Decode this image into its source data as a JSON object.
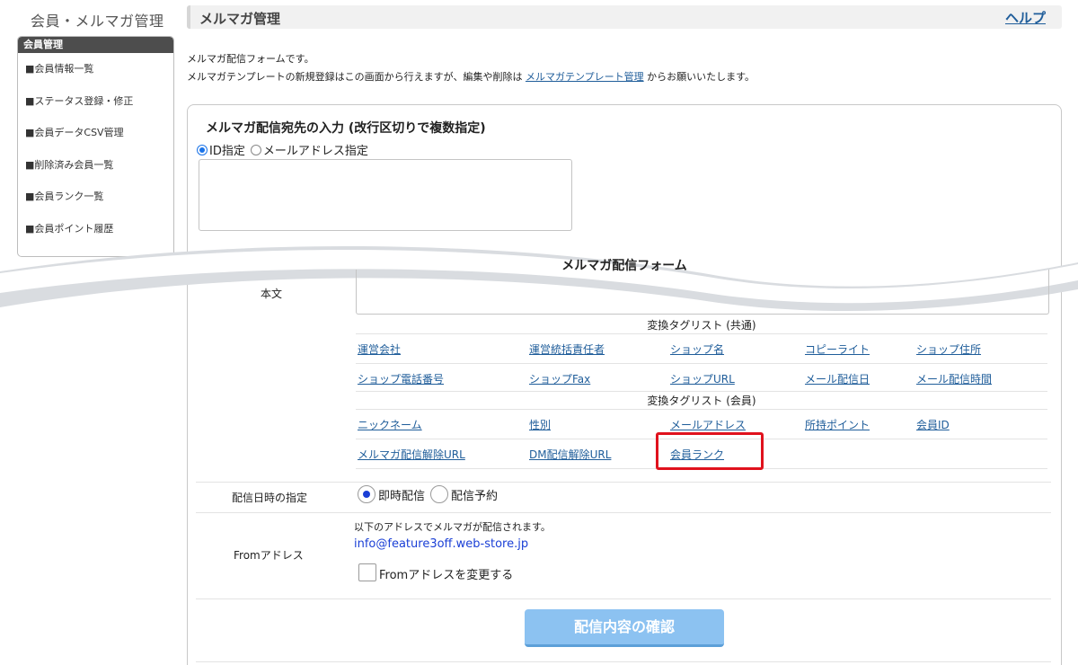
{
  "app_title": "会員・メルマガ管理",
  "sidebar": {
    "heading": "会員管理",
    "items": [
      {
        "label": "■会員情報一覧"
      },
      {
        "label": "■ステータス登録・修正"
      },
      {
        "label": "■会員データCSV管理"
      },
      {
        "label": "■削除済み会員一覧"
      },
      {
        "label": "■会員ランク一覧"
      },
      {
        "label": "■会員ポイント履歴"
      }
    ]
  },
  "header": {
    "title": "メルマガ管理",
    "help_label": "ヘルプ"
  },
  "intro": {
    "line1": "メルマガ配信フォームです。",
    "line2_before": "メルマガテンプレートの新規登録はこの画面から行えますが、編集や削除は",
    "line2_link": "メルマガテンプレート管理",
    "line2_after": "からお願いいたします。"
  },
  "destination": {
    "heading": "メルマガ配信宛先の入力 (改行区切りで複数指定)",
    "option_id": "ID指定",
    "option_email": "メールアドレス指定",
    "selected": "ID指定",
    "textarea_value": ""
  },
  "form": {
    "title": "メルマガ配信フォーム",
    "body_label": "本文",
    "body_value": ""
  },
  "tags": {
    "common_title": "変換タグリスト (共通)",
    "common_rows": [
      [
        "運営会社",
        "運営統括責任者",
        "ショップ名",
        "コピーライト",
        "ショップ住所"
      ],
      [
        "ショップ電話番号",
        "ショップFax",
        "ショップURL",
        "メール配信日",
        "メール配信時間"
      ]
    ],
    "member_title": "変換タグリスト (会員)",
    "member_rows": [
      [
        "ニックネーム",
        "性別",
        "メールアドレス",
        "所持ポイント",
        "会員ID"
      ],
      [
        "メルマガ配信解除URL",
        "DM配信解除URL",
        "会員ランク"
      ]
    ],
    "highlighted": "会員ランク",
    "highlight_color": "#e0121d"
  },
  "delivery": {
    "label": "配信日時の指定",
    "option_immediate": "即時配信",
    "option_scheduled": "配信予約",
    "selected": "即時配信"
  },
  "from": {
    "label": "Fromアドレス",
    "note": "以下のアドレスでメルマガが配信されます。",
    "address": "info@feature3off.web-store.jp",
    "change_label": "Fromアドレスを変更する",
    "change_checked": false
  },
  "confirm_button": "配信内容の確認",
  "colors": {
    "link": "#1f5d9a",
    "accent": "#1a3fd6",
    "button": "#8cc2f1"
  }
}
